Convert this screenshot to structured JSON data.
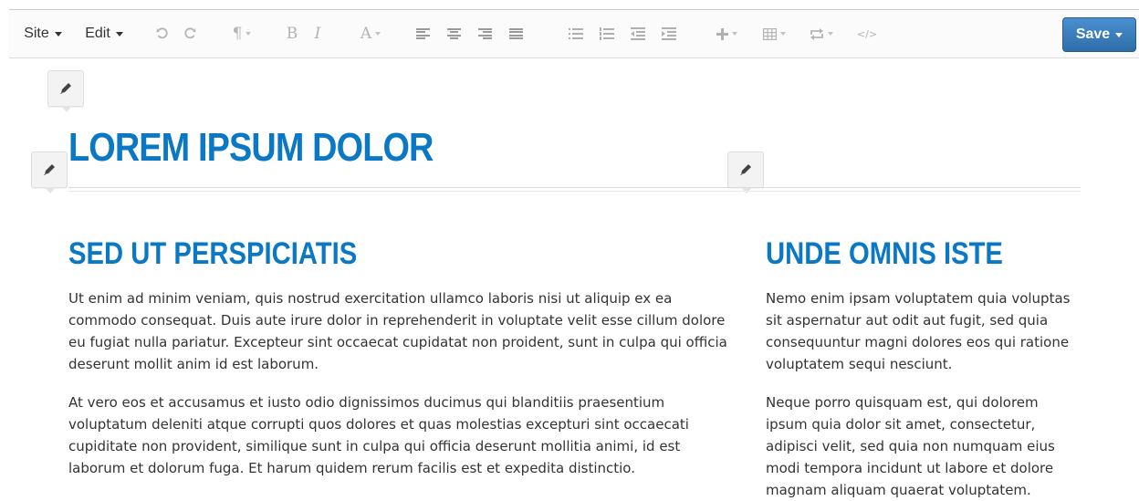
{
  "toolbar": {
    "site_label": "Site",
    "edit_label": "Edit",
    "undo_icon": "undo-icon",
    "redo_icon": "redo-icon",
    "paragraph_glyph": "¶",
    "bold_glyph": "B",
    "italic_glyph": "I",
    "font_glyph": "A",
    "code_glyph": "</>",
    "save_label": "Save"
  },
  "content": {
    "title": "LOREM IPSUM DOLOR",
    "left_heading": "SED UT PERSPICIATIS",
    "left_paragraphs": [
      "Ut enim ad minim veniam, quis nostrud exercitation ullamco laboris nisi ut aliquip ex ea commodo consequat. Duis aute irure dolor in reprehenderit in voluptate velit esse cillum dolore eu fugiat nulla pariatur. Excepteur sint occaecat cupidatat non proident, sunt in culpa qui officia deserunt mollit anim id est laborum.",
      "At vero eos et accusamus et iusto odio dignissimos ducimus qui blanditiis praesentium voluptatum deleniti atque corrupti quos dolores et quas molestias excepturi sint occaecati cupiditate non provident, similique sunt in culpa qui officia deserunt mollitia animi, id est laborum et dolorum fuga. Et harum quidem rerum facilis est et expedita distinctio."
    ],
    "right_heading": "UNDE OMNIS ISTE",
    "right_paragraphs": [
      "Nemo enim ipsam voluptatem quia voluptas sit aspernatur aut odit aut fugit, sed quia consequuntur magni dolores eos qui ratione voluptatem sequi nesciunt.",
      "Neque porro quisquam est, qui dolorem ipsum quia dolor sit amet, consectetur, adipisci velit, sed quia non numquam eius modi tempora incidunt ut labore et dolore magnam aliquam quaerat voluptatem."
    ]
  },
  "colors": {
    "heading_blue": "#0b78c6",
    "save_button": "#3a7fc1",
    "body_text": "#333333"
  }
}
